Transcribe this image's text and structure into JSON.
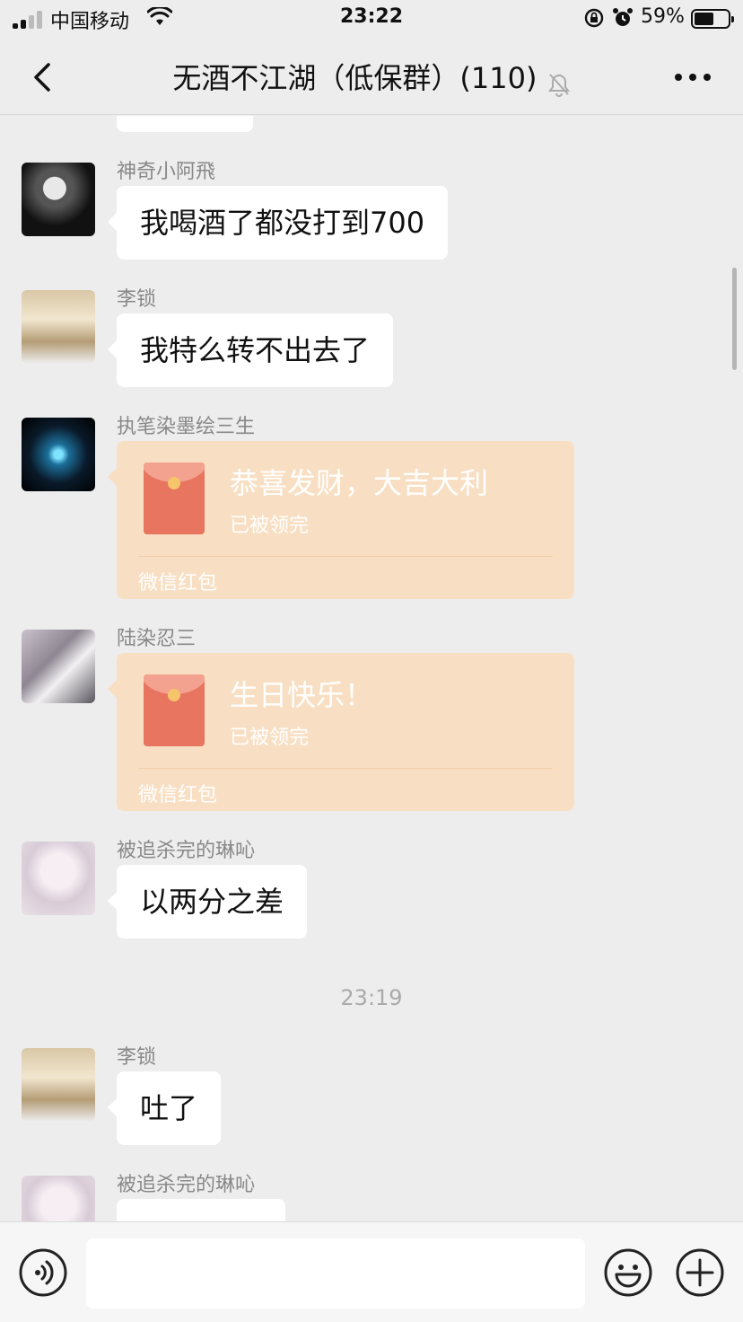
{
  "status_bar": {
    "carrier": "中国移动",
    "time": "23:22",
    "battery_percent": "59%",
    "battery_level": 0.59
  },
  "header": {
    "title": "无酒不江湖（低保群）(110)",
    "back_icon": "chevron-left-icon",
    "mute_icon": "bell-slash-icon",
    "more_icon": "ellipsis-icon"
  },
  "messages": [
    {
      "type": "text",
      "sender": "神奇小阿飛",
      "text": "我喝酒了都没打到700"
    },
    {
      "type": "text",
      "sender": "李锁",
      "text": "我特么转不出去了"
    },
    {
      "type": "red_packet",
      "sender": "执笔染墨绘三生",
      "wish": "恭喜发财，大吉大利",
      "status": "已被领完",
      "brand": "微信红包"
    },
    {
      "type": "red_packet",
      "sender": "陆染忍三",
      "wish": "生日快乐！",
      "status": "已被领完",
      "brand": "微信红包"
    },
    {
      "type": "text",
      "sender": "被追杀完的琳吣",
      "text": "以两分之差"
    },
    {
      "type": "timestamp",
      "text": "23:19"
    },
    {
      "type": "text",
      "sender": "李锁",
      "text": "吐了"
    },
    {
      "type": "text",
      "sender": "被追杀完的琳吣",
      "text": ""
    }
  ],
  "input_bar": {
    "voice_icon": "voice-icon",
    "emoji_icon": "emoji-icon",
    "plus_icon": "plus-circle-icon",
    "value": ""
  },
  "colors": {
    "background": "#ededed",
    "bubble": "#ffffff",
    "red_packet": "#f8dfc3",
    "envelope": "#e77560"
  }
}
